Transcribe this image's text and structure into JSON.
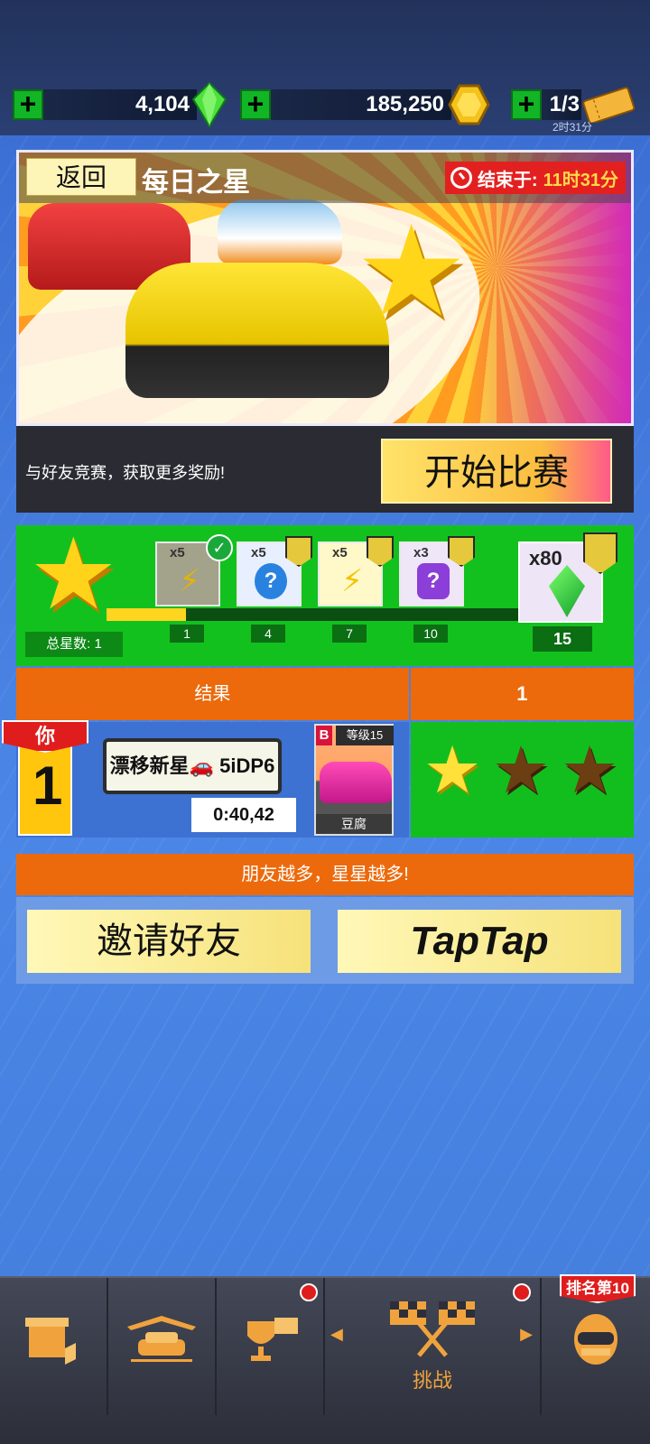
{
  "currency": {
    "gems": "4,104",
    "coins": "185,250",
    "tickets": "1/3",
    "tickets_timer": "2时31分",
    "icons": [
      "plus-icon",
      "gem-icon",
      "coin-icon",
      "ticket-icon"
    ]
  },
  "event": {
    "back_label": "返回",
    "title": "每日之星",
    "ends_label": "结束于:",
    "ends_value": "11时31分"
  },
  "start": {
    "hint": "与好友竞赛，获取更多奖励!",
    "button": "开始比赛"
  },
  "progress": {
    "total_stars": "总星数: 1",
    "current": 1,
    "rewards": [
      {
        "qty": "x5",
        "icon": "lightning-icon",
        "milestone": "1",
        "claimed": true
      },
      {
        "qty": "x5",
        "icon": "mystery-blue-icon",
        "milestone": "4",
        "claimed": false
      },
      {
        "qty": "x5",
        "icon": "lightning-icon",
        "milestone": "7",
        "claimed": false
      },
      {
        "qty": "x3",
        "icon": "mystery-purple-icon",
        "milestone": "10",
        "claimed": false
      }
    ],
    "final": {
      "qty": "x80",
      "icon": "gem-icon",
      "milestone": "15"
    }
  },
  "results": {
    "header_left": "结果",
    "header_right": "1",
    "entry": {
      "rank": "1",
      "you_label": "你",
      "player": "漂移新星🚗 5iDP6",
      "time": "0:40,42",
      "car_grade": "B",
      "car_level": "等级15",
      "car_name": "豆腐",
      "stars_earned": 1,
      "stars_total": 3
    }
  },
  "social": {
    "banner": "朋友越多，星星越多!",
    "invite": "邀请好友",
    "taptap": "TapTap"
  },
  "nav": {
    "challenge_label": "挑战",
    "rank_badge": "排名第10",
    "items": [
      "shop-icon",
      "garage-icon",
      "trophy-icon",
      "challenge-flags-icon",
      "profile-helmet-icon"
    ]
  },
  "colors": {
    "accent_green": "#13c11e",
    "accent_orange": "#ec6a0c",
    "alert_red": "#e01d1d",
    "star_yellow": "#ffd319"
  }
}
